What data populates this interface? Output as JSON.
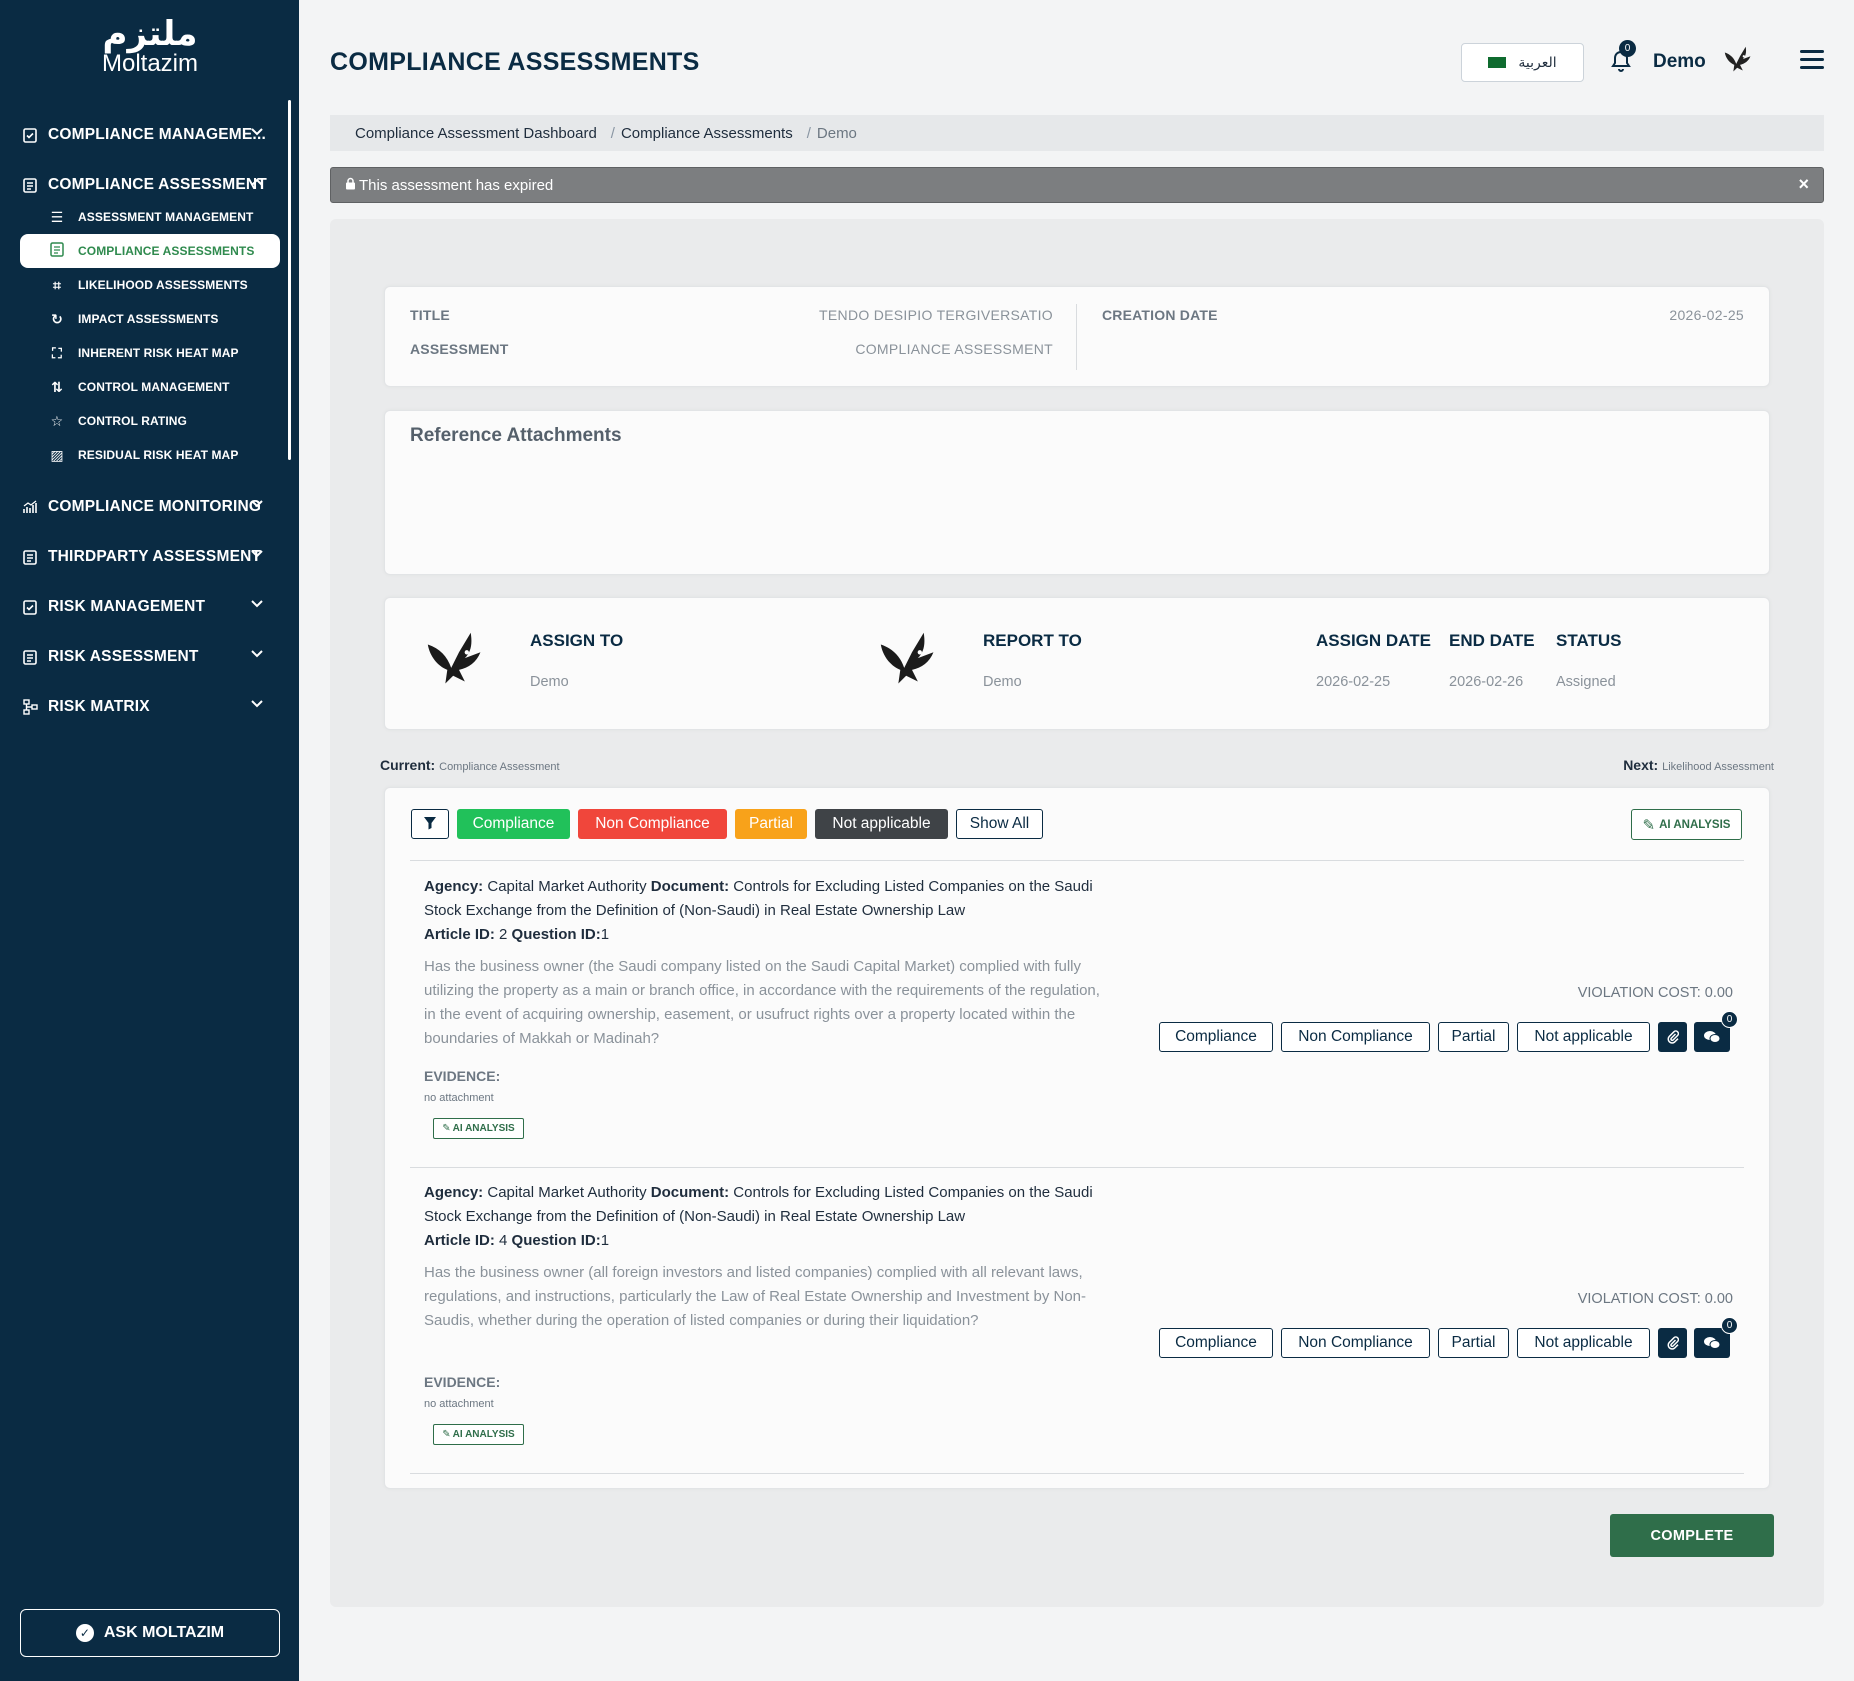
{
  "brand": {
    "logo_ar": "ملتزم",
    "logo_en": "Moltazim"
  },
  "sidebar": {
    "items": [
      {
        "label": "COMPLIANCE MANAGEME...",
        "icon": "clipboard-check-icon"
      },
      {
        "label": "COMPLIANCE ASSESSMENT",
        "icon": "clipboard-list-icon"
      },
      {
        "label": "COMPLIANCE MONITORING",
        "icon": "chart-line-icon"
      },
      {
        "label": "THIRDPARTY ASSESSMENT",
        "icon": "clipboard-list-icon"
      },
      {
        "label": "RISK MANAGEMENT",
        "icon": "clipboard-check-icon"
      },
      {
        "label": "RISK ASSESSMENT",
        "icon": "clipboard-list-icon"
      },
      {
        "label": "RISK MATRIX",
        "icon": "sitemap-icon"
      }
    ],
    "sub_items": [
      {
        "label": "ASSESSMENT MANAGEMENT",
        "icon": "list-search-icon"
      },
      {
        "label": "COMPLIANCE ASSESSMENTS",
        "icon": "clipboard-list-icon"
      },
      {
        "label": "LIKELIHOOD ASSESSMENTS",
        "icon": "nodes-icon"
      },
      {
        "label": "IMPACT ASSESSMENTS",
        "icon": "refresh-icon"
      },
      {
        "label": "INHERENT RISK HEAT MAP",
        "icon": "chart-area-icon"
      },
      {
        "label": "CONTROL MANAGEMENT",
        "icon": "sliders-icon"
      },
      {
        "label": "CONTROL RATING",
        "icon": "star-icon"
      },
      {
        "label": "RESIDUAL RISK HEAT MAP",
        "icon": "image-icon"
      }
    ],
    "ask_label": "ASK MOLTAZIM"
  },
  "header": {
    "title": "COMPLIANCE ASSESSMENTS",
    "language": "العربية",
    "notification_count": "0",
    "user_name": "Demo"
  },
  "breadcrumb": [
    "Compliance Assessment Dashboard",
    "Compliance Assessments",
    "Demo"
  ],
  "alert": {
    "text": "This assessment has expired",
    "close": "×"
  },
  "summary": {
    "title_label": "TITLE",
    "title_value": "TENDO DESIPIO TERGIVERSATIO",
    "assessment_label": "ASSESSMENT",
    "assessment_value": "COMPLIANCE ASSESSMENT",
    "creation_label": "CREATION DATE",
    "creation_value": "2026-02-25"
  },
  "reference": {
    "title": "Reference Attachments"
  },
  "assignment": {
    "assign_to_label": "ASSIGN TO",
    "assign_to_value": "Demo",
    "report_to_label": "REPORT TO",
    "report_to_value": "Demo",
    "assign_date_label": "ASSIGN DATE",
    "assign_date_value": "2026-02-25",
    "end_date_label": "END DATE",
    "end_date_value": "2026-02-26",
    "status_label": "STATUS",
    "status_value": "Assigned"
  },
  "workflow": {
    "current_label": "Current:",
    "current_value": "Compliance Assessment",
    "next_label": "Next:",
    "next_value": "Likelihood Assessment"
  },
  "filters": {
    "compliance": "Compliance",
    "non_compliance": "Non Compliance",
    "partial": "Partial",
    "not_applicable": "Not applicable",
    "show_all": "Show All",
    "ai_analysis": "AI ANALYSIS"
  },
  "colors": {
    "sidebar": "#0a2b43",
    "compliance": "#21c15a",
    "non_compliance": "#f0463b",
    "partial": "#f8a21a",
    "not_applicable": "#3f4347",
    "accent_green": "#2f6e4a"
  },
  "questions": [
    {
      "agency_label": "Agency:",
      "agency": "Capital Market Authority",
      "document_label": "Document:",
      "document": "Controls for Excluding Listed Companies on the Saudi Stock Exchange from the Definition of (Non-Saudi) in Real Estate Ownership Law",
      "article_label": "Article ID:",
      "article_id": "2",
      "question_label": "Question ID:",
      "question_id": "1",
      "text": "Has the business owner (the Saudi company listed on the Saudi Capital Market) complied with fully utilizing the property as a main or branch office, in accordance with the requirements of the regulation, in the event of acquiring ownership, easement, or usufruct rights over a property located within the boundaries of Makkah or Madinah?",
      "evidence_label": "EVIDENCE:",
      "evidence_value": "no attachment",
      "ai_label": "AI ANALYSIS",
      "violation_cost": "VIOLATION COST: 0.00",
      "comment_count": "0"
    },
    {
      "agency_label": "Agency:",
      "agency": "Capital Market Authority",
      "document_label": "Document:",
      "document": "Controls for Excluding Listed Companies on the Saudi Stock Exchange from the Definition of (Non-Saudi) in Real Estate Ownership Law",
      "article_label": "Article ID:",
      "article_id": "4",
      "question_label": "Question ID:",
      "question_id": "1",
      "text": "Has the business owner (all foreign investors and listed companies) complied with all relevant laws, regulations, and instructions, particularly the Law of Real Estate Ownership and Investment by Non-Saudis, whether during the operation of listed companies or during their liquidation?",
      "evidence_label": "EVIDENCE:",
      "evidence_value": "no attachment",
      "ai_label": "AI ANALYSIS",
      "violation_cost": "VIOLATION COST: 0.00",
      "comment_count": "0"
    }
  ],
  "answer_buttons": {
    "compliance": "Compliance",
    "non_compliance": "Non Compliance",
    "partial": "Partial",
    "not_applicable": "Not applicable"
  },
  "complete_label": "COMPLETE"
}
